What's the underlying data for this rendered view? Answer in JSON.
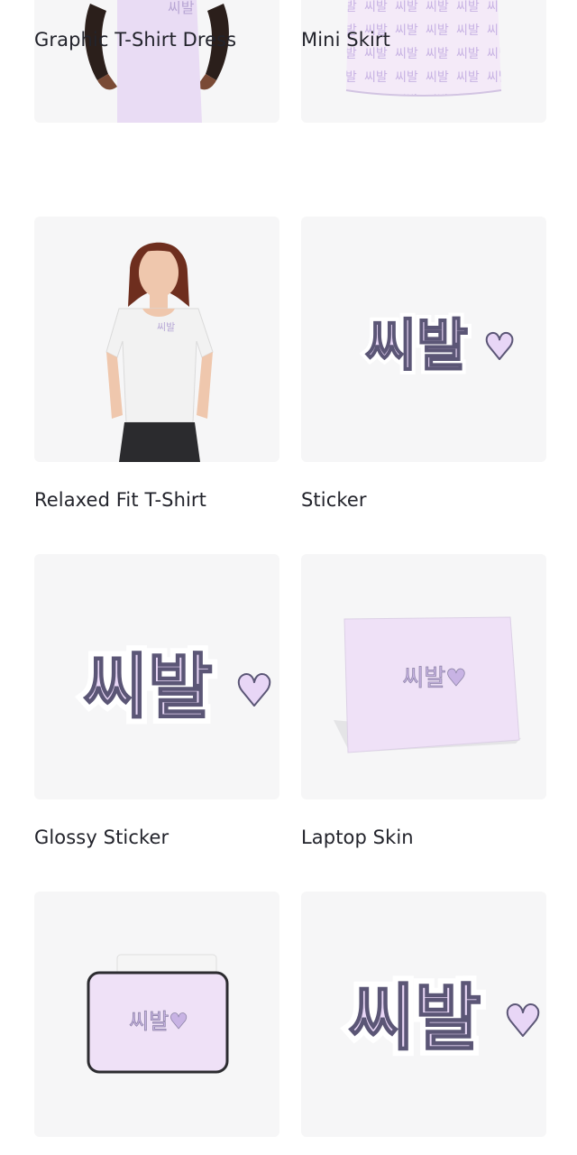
{
  "products": [
    {
      "title": "Graphic T-Shirt Dress",
      "image": "graphic-t-shirt-dress"
    },
    {
      "title": "Mini Skirt",
      "image": "mini-skirt"
    },
    {
      "title": "Relaxed Fit T-Shirt",
      "image": "relaxed-fit-t-shirt"
    },
    {
      "title": "Sticker",
      "image": "sticker"
    },
    {
      "title": "Glossy Sticker",
      "image": "glossy-sticker"
    },
    {
      "title": "Laptop Skin",
      "image": "laptop-skin"
    },
    {
      "title": "",
      "image": "laptop-sleeve"
    },
    {
      "title": "",
      "image": "sticker"
    }
  ],
  "design": {
    "text": "씨발",
    "heart": "♥",
    "colors": {
      "lavender": "#e9d6f6",
      "mint": "#d2f5ee",
      "outline": "#5b5676"
    }
  }
}
